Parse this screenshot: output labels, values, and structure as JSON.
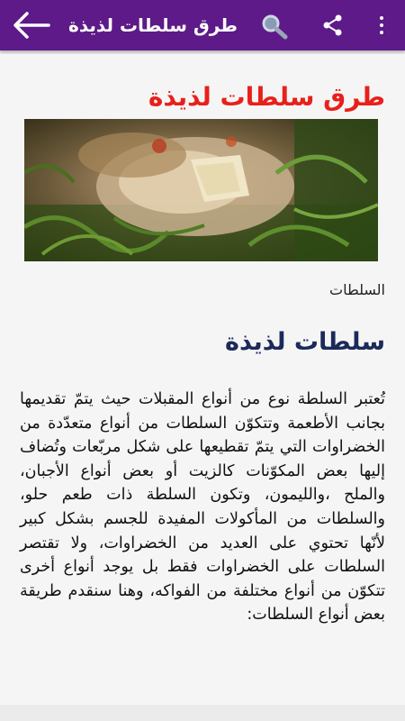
{
  "app_bar": {
    "title": "طرق سلطات لذيذة",
    "back_icon": "arrow-left-icon",
    "search_icon": "search-icon",
    "share_icon": "share-icon",
    "menu_icon": "more-vertical-icon",
    "background_color": "#5d1a88"
  },
  "article": {
    "title": "طرق سلطات لذيذة",
    "title_color": "#e8201a",
    "image_description": "salad-photo",
    "caption": "السلطات",
    "heading": "سلطات لذيذة",
    "heading_color": "#1c2a5a",
    "body": "تُعتبر السلطة نوع من أنواع المقبلات حيث يتمّ تقديمها بجانب الأطعمة وتتكوّن السلطات من أنواع متعدّدة من الخضراوات التي يتمّ تقطيعها على شكل مربّعات وتُضاف إليها بعض المكوّنات كالزيت أو بعض أنواع الأجبان، والملح ،والليمون، وتكون السلطة ذات طعم حلو، والسلطات من المأكولات المفيدة للجسم بشكل كبير لأنّها تحتوي على العديد من الخضراوات، ولا تقتصر السلطات على الخضراوات فقط بل يوجد أنواع أخرى تتكوّن من أنواع مختلفة من الفواكه، وهنا سنقدم طريقة بعض أنواع السلطات:"
  }
}
